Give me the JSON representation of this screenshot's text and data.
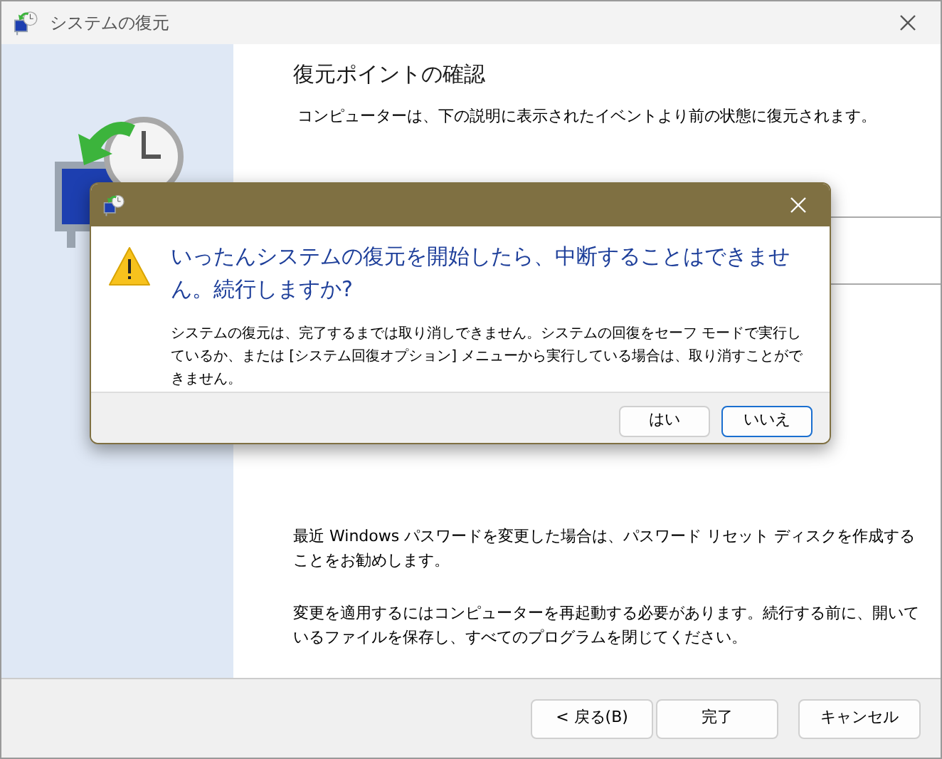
{
  "window": {
    "title": "システムの復元"
  },
  "page": {
    "heading": "復元ポイントの確認",
    "intro": "コンピューターは、下の説明に表示されたイベントより前の状態に復元されます。",
    "notes": [
      "最近 Windows パスワードを変更した場合は、パスワード リセット ディスクを作成することをお勧めします。",
      "変更を適用するにはコンピューターを再起動する必要があります。続行する前に、開いているファイルを保存し、すべてのプログラムを閉じてください。"
    ]
  },
  "buttons": [
    {
      "label": "< 戻る(B)"
    },
    {
      "label": "完了"
    },
    {
      "label": "キャンセル"
    }
  ],
  "dialog": {
    "message": "いったんシステムの復元を開始したら、中断することはできません。続行しますか?",
    "detail": "システムの復元は、完了するまでは取り消しできません。システムの回復をセーフ モードで実行しているか、または [システム回復オプション] メニューから実行している場合は、取り消すことができません。",
    "buttons": [
      {
        "label": "はい",
        "default": false
      },
      {
        "label": "いいえ",
        "default": true
      }
    ]
  }
}
